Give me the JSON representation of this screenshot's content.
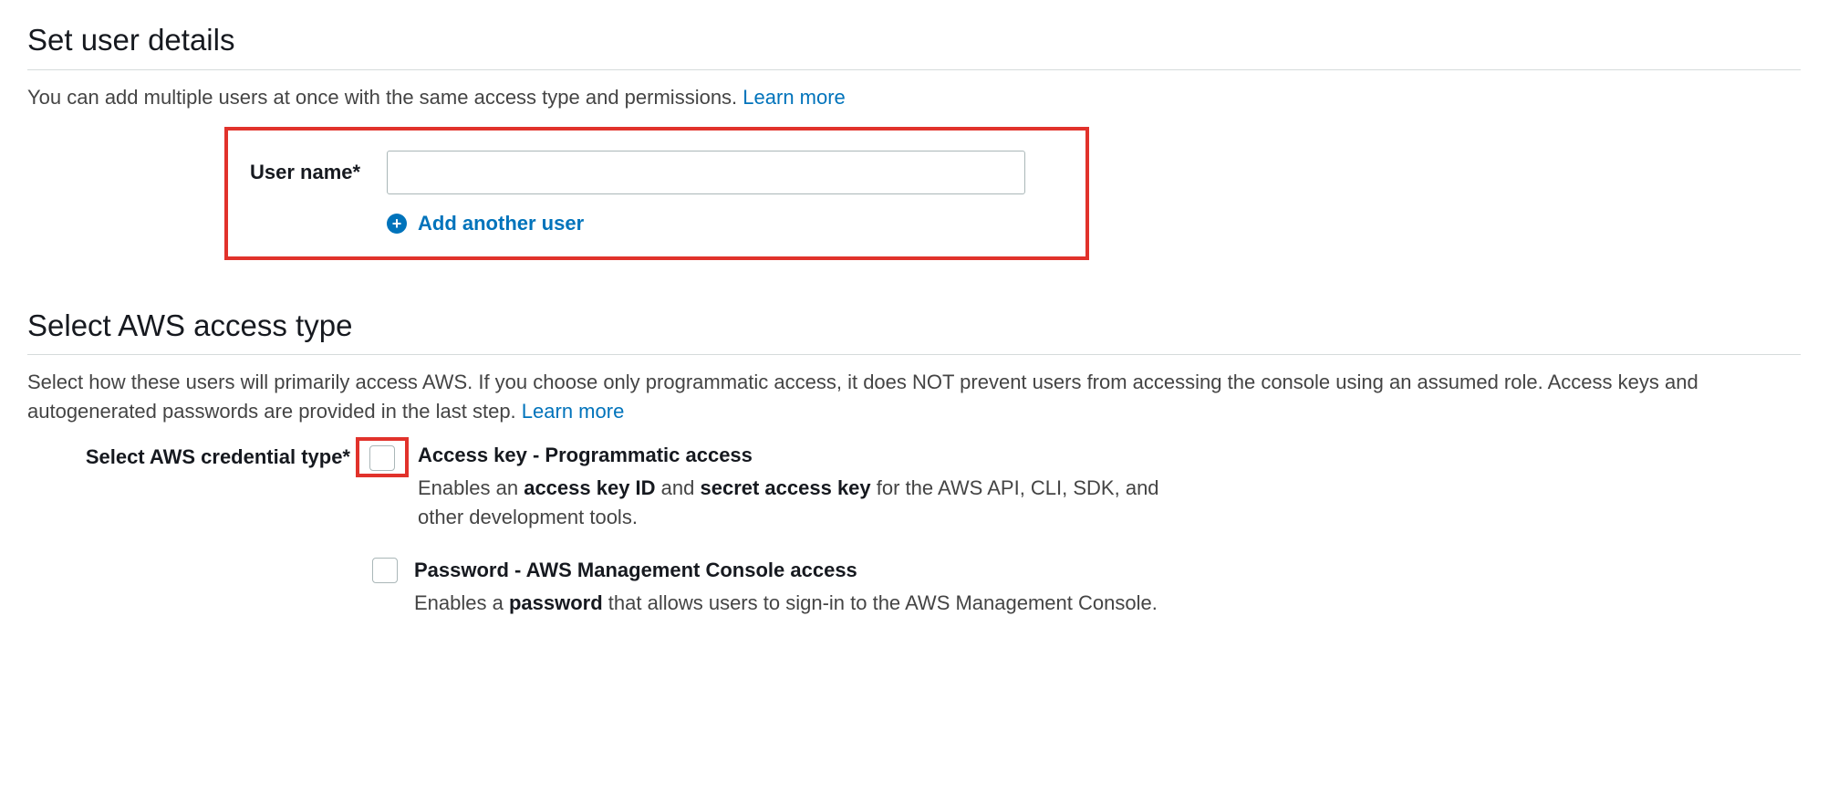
{
  "section1": {
    "heading": "Set user details",
    "desc": "You can add multiple users at once with the same access type and permissions. ",
    "learn_more": "Learn more",
    "username_label": "User name*",
    "username_value": "",
    "add_another": "Add another user"
  },
  "section2": {
    "heading": "Select AWS access type",
    "desc": "Select how these users will primarily access AWS. If you choose only programmatic access, it does NOT prevent users from accessing the console using an assumed role. Access keys and autogenerated passwords are provided in the last step. ",
    "learn_more": "Learn more",
    "cred_label": "Select AWS credential type*",
    "option1": {
      "title": "Access key - Programmatic access",
      "desc_pre": "Enables an ",
      "desc_b1": "access key ID",
      "desc_mid": " and ",
      "desc_b2": "secret access key",
      "desc_post": " for the AWS API, CLI, SDK, and other development tools."
    },
    "option2": {
      "title": "Password - AWS Management Console access",
      "desc_pre": "Enables a ",
      "desc_b1": "password",
      "desc_post": " that allows users to sign-in to the AWS Management Console."
    }
  }
}
